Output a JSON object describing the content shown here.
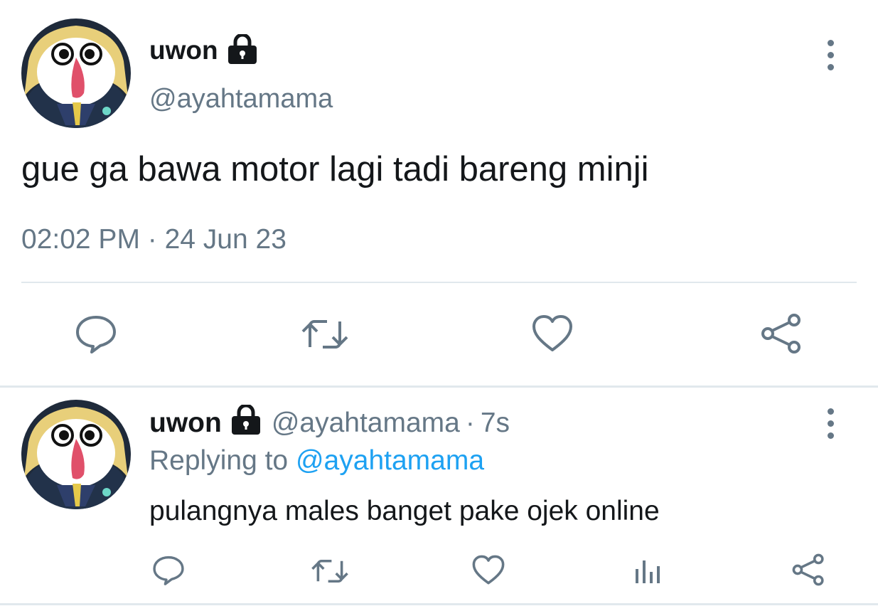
{
  "main_tweet": {
    "display_name": "uwon",
    "handle": "@ayahtamama",
    "text": "gue ga bawa motor lagi tadi bareng minji",
    "timestamp": "02:02 PM · 24 Jun 23",
    "avatar_icon": "keroro-character-avatar",
    "lock_icon": "lock-icon",
    "actions": [
      "reply-icon",
      "retweet-icon",
      "like-icon",
      "share-icon"
    ]
  },
  "reply_tweet": {
    "display_name": "uwon",
    "handle": "@ayahtamama",
    "separator": "·",
    "time": "7s",
    "replying_to_label": "Replying to",
    "replying_to_handle": "@ayahtamama",
    "text": "pulangnya males banget pake ojek online",
    "avatar_icon": "keroro-character-avatar",
    "actions": [
      "reply-icon",
      "retweet-icon",
      "like-icon",
      "analytics-icon",
      "share-icon"
    ]
  },
  "colors": {
    "text": "#14171a",
    "muted": "#657786",
    "link": "#1da1f2",
    "divider": "#e1e8ed"
  }
}
